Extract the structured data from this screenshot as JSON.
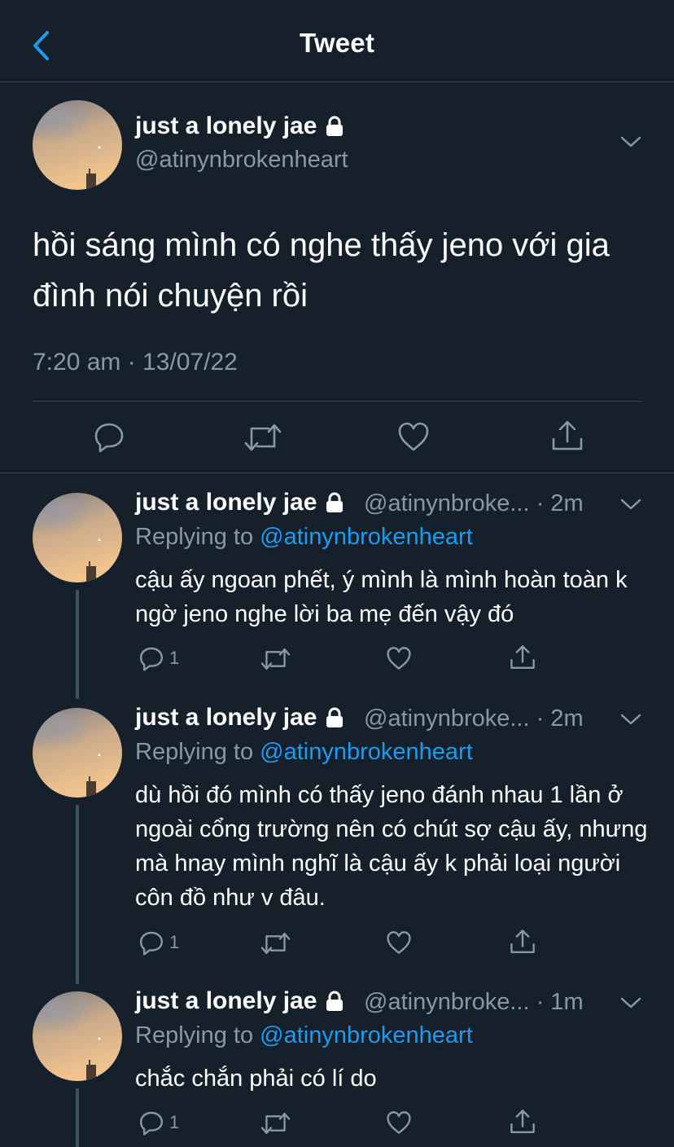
{
  "header": {
    "title": "Tweet"
  },
  "main_tweet": {
    "display_name": "just a lonely jae",
    "handle": "@atinynbrokenheart",
    "text": "hồi sáng mình có nghe thấy jeno với gia đình nói chuyện rồi",
    "timestamp": "7:20 am · 13/07/22"
  },
  "replies": [
    {
      "display_name": "just a lonely jae",
      "handle_time": "@atinynbroke... · 2m",
      "replying_prefix": "Replying to ",
      "replying_to": "@atinynbrokenheart",
      "text": "cậu ấy ngoan phết, ý mình là mình hoàn toàn k ngờ jeno nghe lời ba mẹ đến vậy đó",
      "reply_count": "1"
    },
    {
      "display_name": "just a lonely jae",
      "handle_time": "@atinynbroke... · 2m",
      "replying_prefix": "Replying to ",
      "replying_to": "@atinynbrokenheart",
      "text": "dù hồi đó mình có thấy jeno đánh nhau 1 lần ở ngoài cổng trường nên có chút sợ cậu ấy, nhưng mà hnay mình nghĩ là cậu ấy k phải loại người côn đồ như v đâu.",
      "reply_count": "1"
    },
    {
      "display_name": "just a lonely jae",
      "handle_time": "@atinynbroke... · 1m",
      "replying_prefix": "Replying to ",
      "replying_to": "@atinynbrokenheart",
      "text": "chắc chắn phải có lí do",
      "reply_count": "1"
    }
  ],
  "colors": {
    "background": "#15202b",
    "secondary_text": "#8899a6",
    "link": "#1d9bf0",
    "divider": "#38444d"
  }
}
